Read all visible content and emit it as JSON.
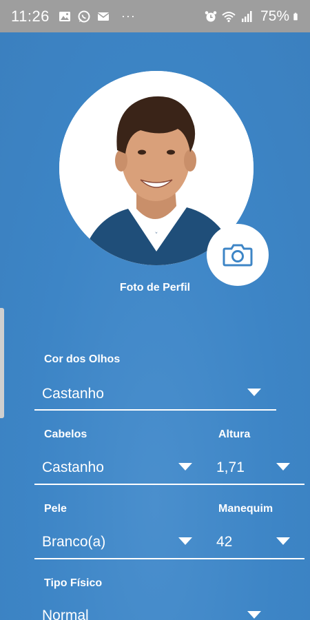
{
  "status_bar": {
    "time": "11:26",
    "dots": "···",
    "battery_percent": "75%",
    "icons_left": [
      "gallery-icon",
      "whatsapp-icon",
      "mail-icon"
    ],
    "icons_right": [
      "alarm-icon",
      "wifi-icon",
      "signal-icon",
      "battery-icon"
    ]
  },
  "profile": {
    "photo_label": "Foto de Perfil",
    "camera_icon": "camera-icon"
  },
  "form": {
    "eye_color": {
      "label": "Cor dos Olhos",
      "value": "Castanho"
    },
    "hair": {
      "label": "Cabelos",
      "value": "Castanho"
    },
    "height": {
      "label": "Altura",
      "value": "1,71"
    },
    "skin": {
      "label": "Pele",
      "value": "Branco(a)"
    },
    "size": {
      "label": "Manequim",
      "value": "42"
    },
    "body_type": {
      "label": "Tipo Físico",
      "value": "Normal"
    }
  },
  "colors": {
    "background": "#3d85c6",
    "status_bar": "#9e9e9e",
    "text": "#ffffff",
    "camera_icon": "#3d85c6"
  }
}
